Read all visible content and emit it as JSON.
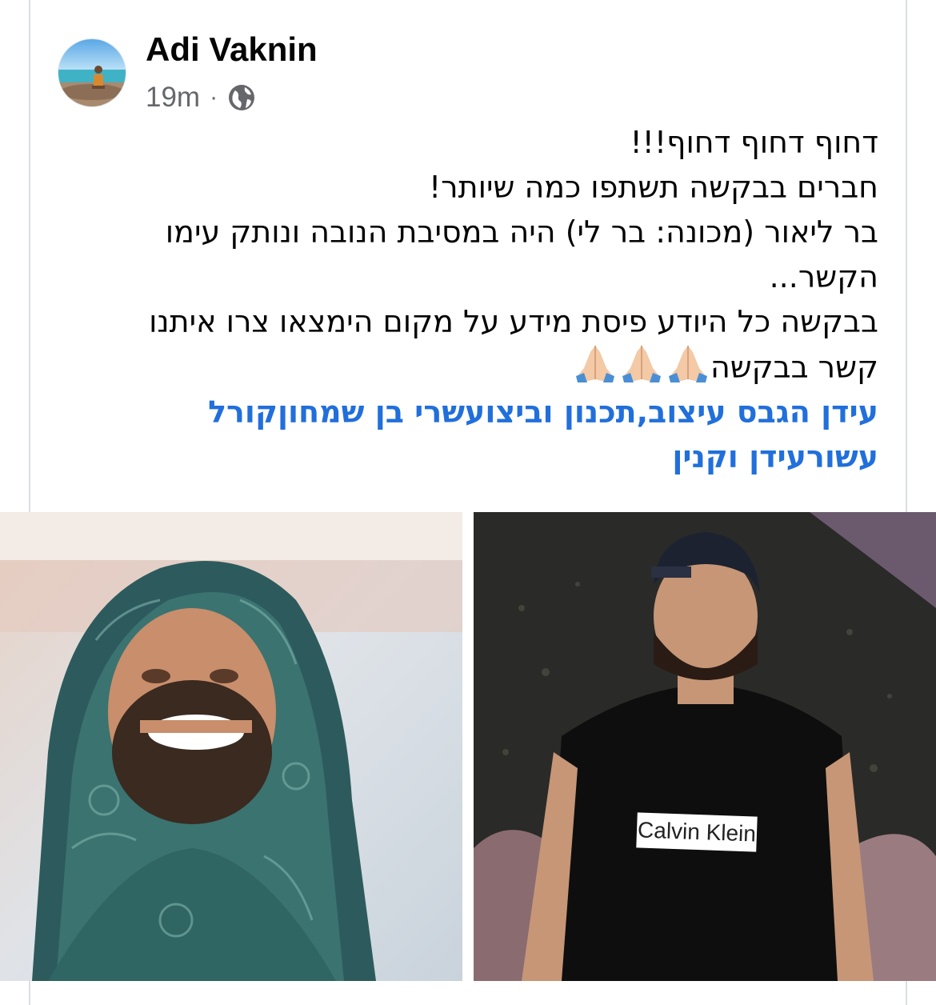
{
  "post": {
    "author": "Adi Vaknin",
    "time": "19m",
    "separator": "·",
    "privacy_icon": "globe-icon",
    "lines": [
      "דחוף דחוף דחוף!!!",
      "חברים בבקשה תשתפו כמה שיותר!",
      "בר ליאור (מכונה: בר לי) היה במסיבת הנובה ונותק עימו",
      "הקשר...",
      "בבקשה כל היודע פיסת מידע על מקום הימצאו צרו איתנו",
      "קשר בבקשה"
    ],
    "emoji_icon": "folded-hands-icon",
    "emoji_count": 3,
    "tags": "עידן הגבס עיצוב,תכנון וביצועשרי בן שמחוןקורל עשורעידן וקנין"
  },
  "photos": {
    "right_shirt_text": "Calvin Klein"
  },
  "colors": {
    "link": "#216fdb",
    "meta": "#65676b",
    "text": "#050505"
  }
}
